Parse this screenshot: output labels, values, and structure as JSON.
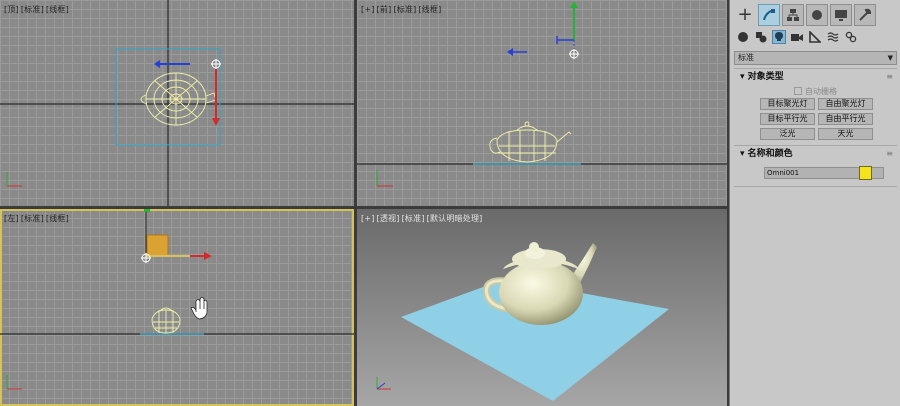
{
  "viewports": {
    "top": {
      "label": [
        "[顶]",
        "[标准]",
        "[线框]"
      ]
    },
    "front": {
      "label": [
        "[+]",
        "[前]",
        "[标准]",
        "[线框]"
      ]
    },
    "left": {
      "label": [
        "[左]",
        "[标准]",
        "[线框]"
      ]
    },
    "perspective": {
      "label": [
        "[+]",
        "[透视]",
        "[标准]",
        "[默认明暗处理]"
      ]
    }
  },
  "panel": {
    "tabs": [
      {
        "icon": "plus-icon",
        "label": "+"
      },
      {
        "icon": "modify-icon"
      },
      {
        "icon": "hierarchy-icon"
      },
      {
        "icon": "motion-icon"
      },
      {
        "icon": "display-icon"
      },
      {
        "icon": "utilities-icon"
      }
    ],
    "subtabs": [
      "geometry-icon",
      "shapes-icon",
      "lights-icon",
      "cameras-icon",
      "helpers-icon",
      "spacewarps-icon",
      "systems-icon"
    ],
    "category_dropdown": "标准",
    "object_type": {
      "title": "对象类型",
      "autogrid": "自动栅格",
      "buttons": [
        "目标聚光灯",
        "自由聚光灯",
        "目标平行光",
        "自由平行光",
        "泛光",
        "天光"
      ]
    },
    "name_color": {
      "title": "名称和颜色",
      "name_value": "Omni001",
      "color": "#f4e21a"
    }
  },
  "colors": {
    "wire": "#f2f0a8",
    "gizmo_x": "#d42a2a",
    "gizmo_y": "#27b336",
    "gizmo_z": "#2540d8",
    "ground": "#8fd0e6",
    "bbox": "#2fa5c8"
  }
}
